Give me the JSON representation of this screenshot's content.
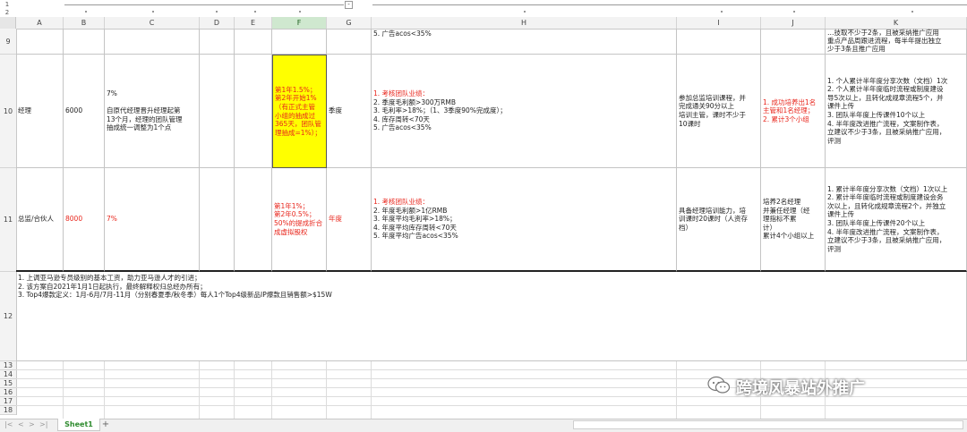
{
  "outline": {
    "levels": [
      "1",
      "2"
    ],
    "collapse_symbol": "-"
  },
  "columns": [
    "A",
    "B",
    "C",
    "D",
    "E",
    "F",
    "G",
    "H",
    "I",
    "J",
    "K"
  ],
  "selected_column": "F",
  "row_numbers": {
    "r9": "9",
    "r10": "10",
    "r11": "11",
    "r12": "12",
    "r13": "13",
    "r14": "14",
    "r15": "15",
    "r16": "16",
    "r17": "17",
    "r18": "18"
  },
  "rows": {
    "r9": {
      "H": "5. 广告acos<35%",
      "K": "…技取不少于2条，且被采纳推广应用\n重点产品周跟进流程，每半年提出独立\n少于3条且推广应用"
    },
    "r10": {
      "A": "经理",
      "B": "6000",
      "C": "7%\n\n自原代经理晋升经理起第\n13个月，经理的团队管理\n抽成统一调整为1个点",
      "F": "第1年1.5%；\n第2年开始1%\n（有正式主管\n小组的抽成过\n365天，团队管\n理抽成=1%）；",
      "G": "季度",
      "H": "1. 考核团队业绩：\n2. 季度毛利额>300万RMB\n3. 毛利率>18%；（1、3季度90%完成度）；\n4. 库存周转<70天\n5. 广告acos<35%",
      "I": "参加总监培训课程，并\n完成通关90分以上\n培训主管，课时不少于\n10课时",
      "J": "1. 成功培养出1名\n主管和1名经理；\n2. 累计3个小组",
      "K": "1. 个人累计半年度分享次数（文档）1次\n2. 个人累计半年度临时流程或制度建设\n导5次以上，且转化成规章流程5个，并\n课件上传\n3. 团队半年度上传课件10个以上\n4. 半年度改进推广流程，文案制作表，\n立建议不少于3条，且被采纳推广应用，\n评测"
    },
    "r11": {
      "A": "总监/合伙人",
      "B": "8000",
      "C": "7%",
      "F": "第1年1%；\n第2年0.5%；\n50%的提成折合\n成虚拟股权",
      "G": "年度",
      "H": "1. 考核团队业绩：\n2. 年度毛利额>1亿RMB\n3. 年度平均毛利率>18%；\n4. 年度平均库存周转<70天\n5. 年度平均广告acos<35%",
      "I": "具备经理培训能力，培\n训课时20课时（人资存\n档）",
      "J": "培养2名经理\n并兼任经理（经\n理指标不累\n计）\n累计4个小组以上",
      "K": "1. 累计半年度分享次数（文档）1次以上\n2. 累计半年度临时流程或制度建设会务\n次以上，且转化成规章流程2个，并独立\n课件上传\n3. 团队半年度上传课件20个以上\n4. 半年度改进推广流程，文案制作表，\n立建议不少于3条，且被采纳推广应用，\n评测"
    },
    "r12": {
      "A": "1. 上调亚马逊专员级别的基本工资，助力亚马逊人才的引进；\n2. 该方案自2021年1月1日起执行，最终解释权归总经办所有；\n3. Top4爆款定义：1月-6月/7月-11月（分别春夏季/秋冬季）每人1个Top4级新品IP爆款且销售额>$15W"
    }
  },
  "sheet_tabs": [
    "Sheet1"
  ],
  "add_sheet_symbol": "+",
  "nav_arrows": [
    "|<",
    "<",
    ">",
    ">|"
  ],
  "watermark": {
    "text": "跨境风暴站外推广",
    "icon": "wechat-icon"
  },
  "colors": {
    "highlight_yellow": "#ffff00",
    "red_text": "#e8261c",
    "selected_header": "#cfe8cf",
    "sheet_tab_green": "#2e8b2e"
  }
}
